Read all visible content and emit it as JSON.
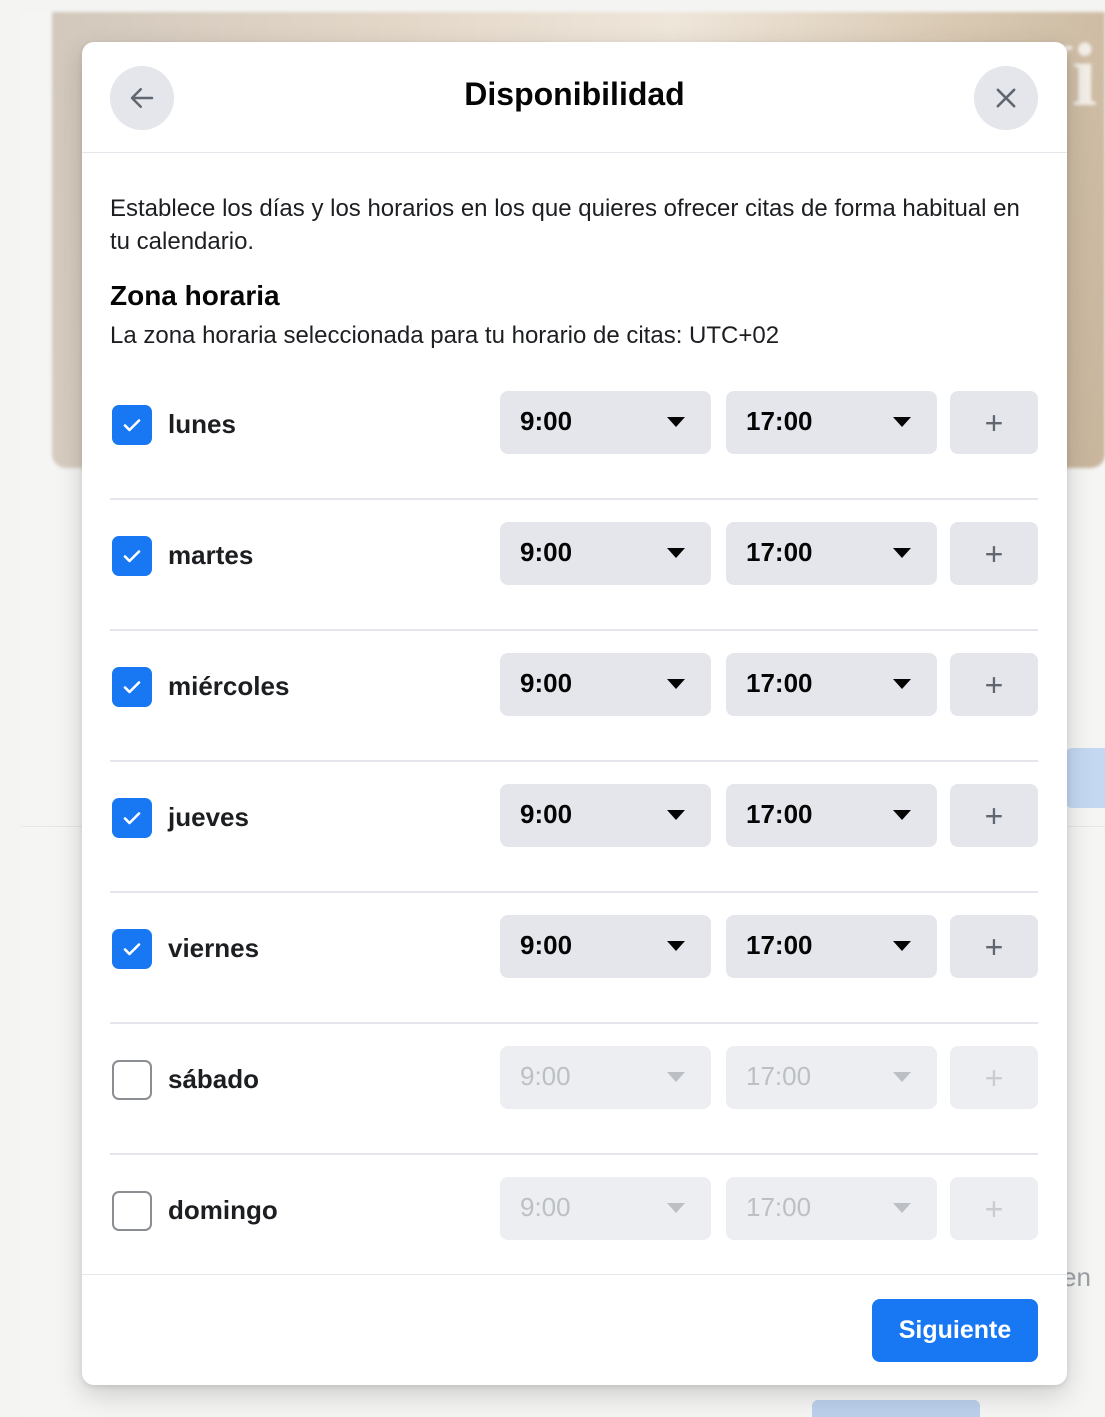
{
  "background": {
    "cover_text": "Vi",
    "side_text": "en"
  },
  "modal": {
    "title": "Disponibilidad",
    "back_icon": "arrow-left-icon",
    "close_icon": "close-icon",
    "description": "Establece los días y los horarios en los que quieres ofrecer citas de forma habitual en tu calendario.",
    "timezone_title": "Zona horaria",
    "timezone_text": "La zona horaria seleccionada para tu horario de citas: UTC+02",
    "days": [
      {
        "label": "lunes",
        "checked": true,
        "start": "9:00",
        "end": "17:00"
      },
      {
        "label": "martes",
        "checked": true,
        "start": "9:00",
        "end": "17:00"
      },
      {
        "label": "miércoles",
        "checked": true,
        "start": "9:00",
        "end": "17:00"
      },
      {
        "label": "jueves",
        "checked": true,
        "start": "9:00",
        "end": "17:00"
      },
      {
        "label": "viernes",
        "checked": true,
        "start": "9:00",
        "end": "17:00"
      },
      {
        "label": "sábado",
        "checked": false,
        "start": "9:00",
        "end": "17:00"
      },
      {
        "label": "domingo",
        "checked": false,
        "start": "9:00",
        "end": "17:00"
      }
    ],
    "add_symbol": "+",
    "next_label": "Siguiente"
  },
  "colors": {
    "accent": "#1877f2",
    "control_bg": "#e4e6eb",
    "disabled_text": "#bcc0c4"
  }
}
